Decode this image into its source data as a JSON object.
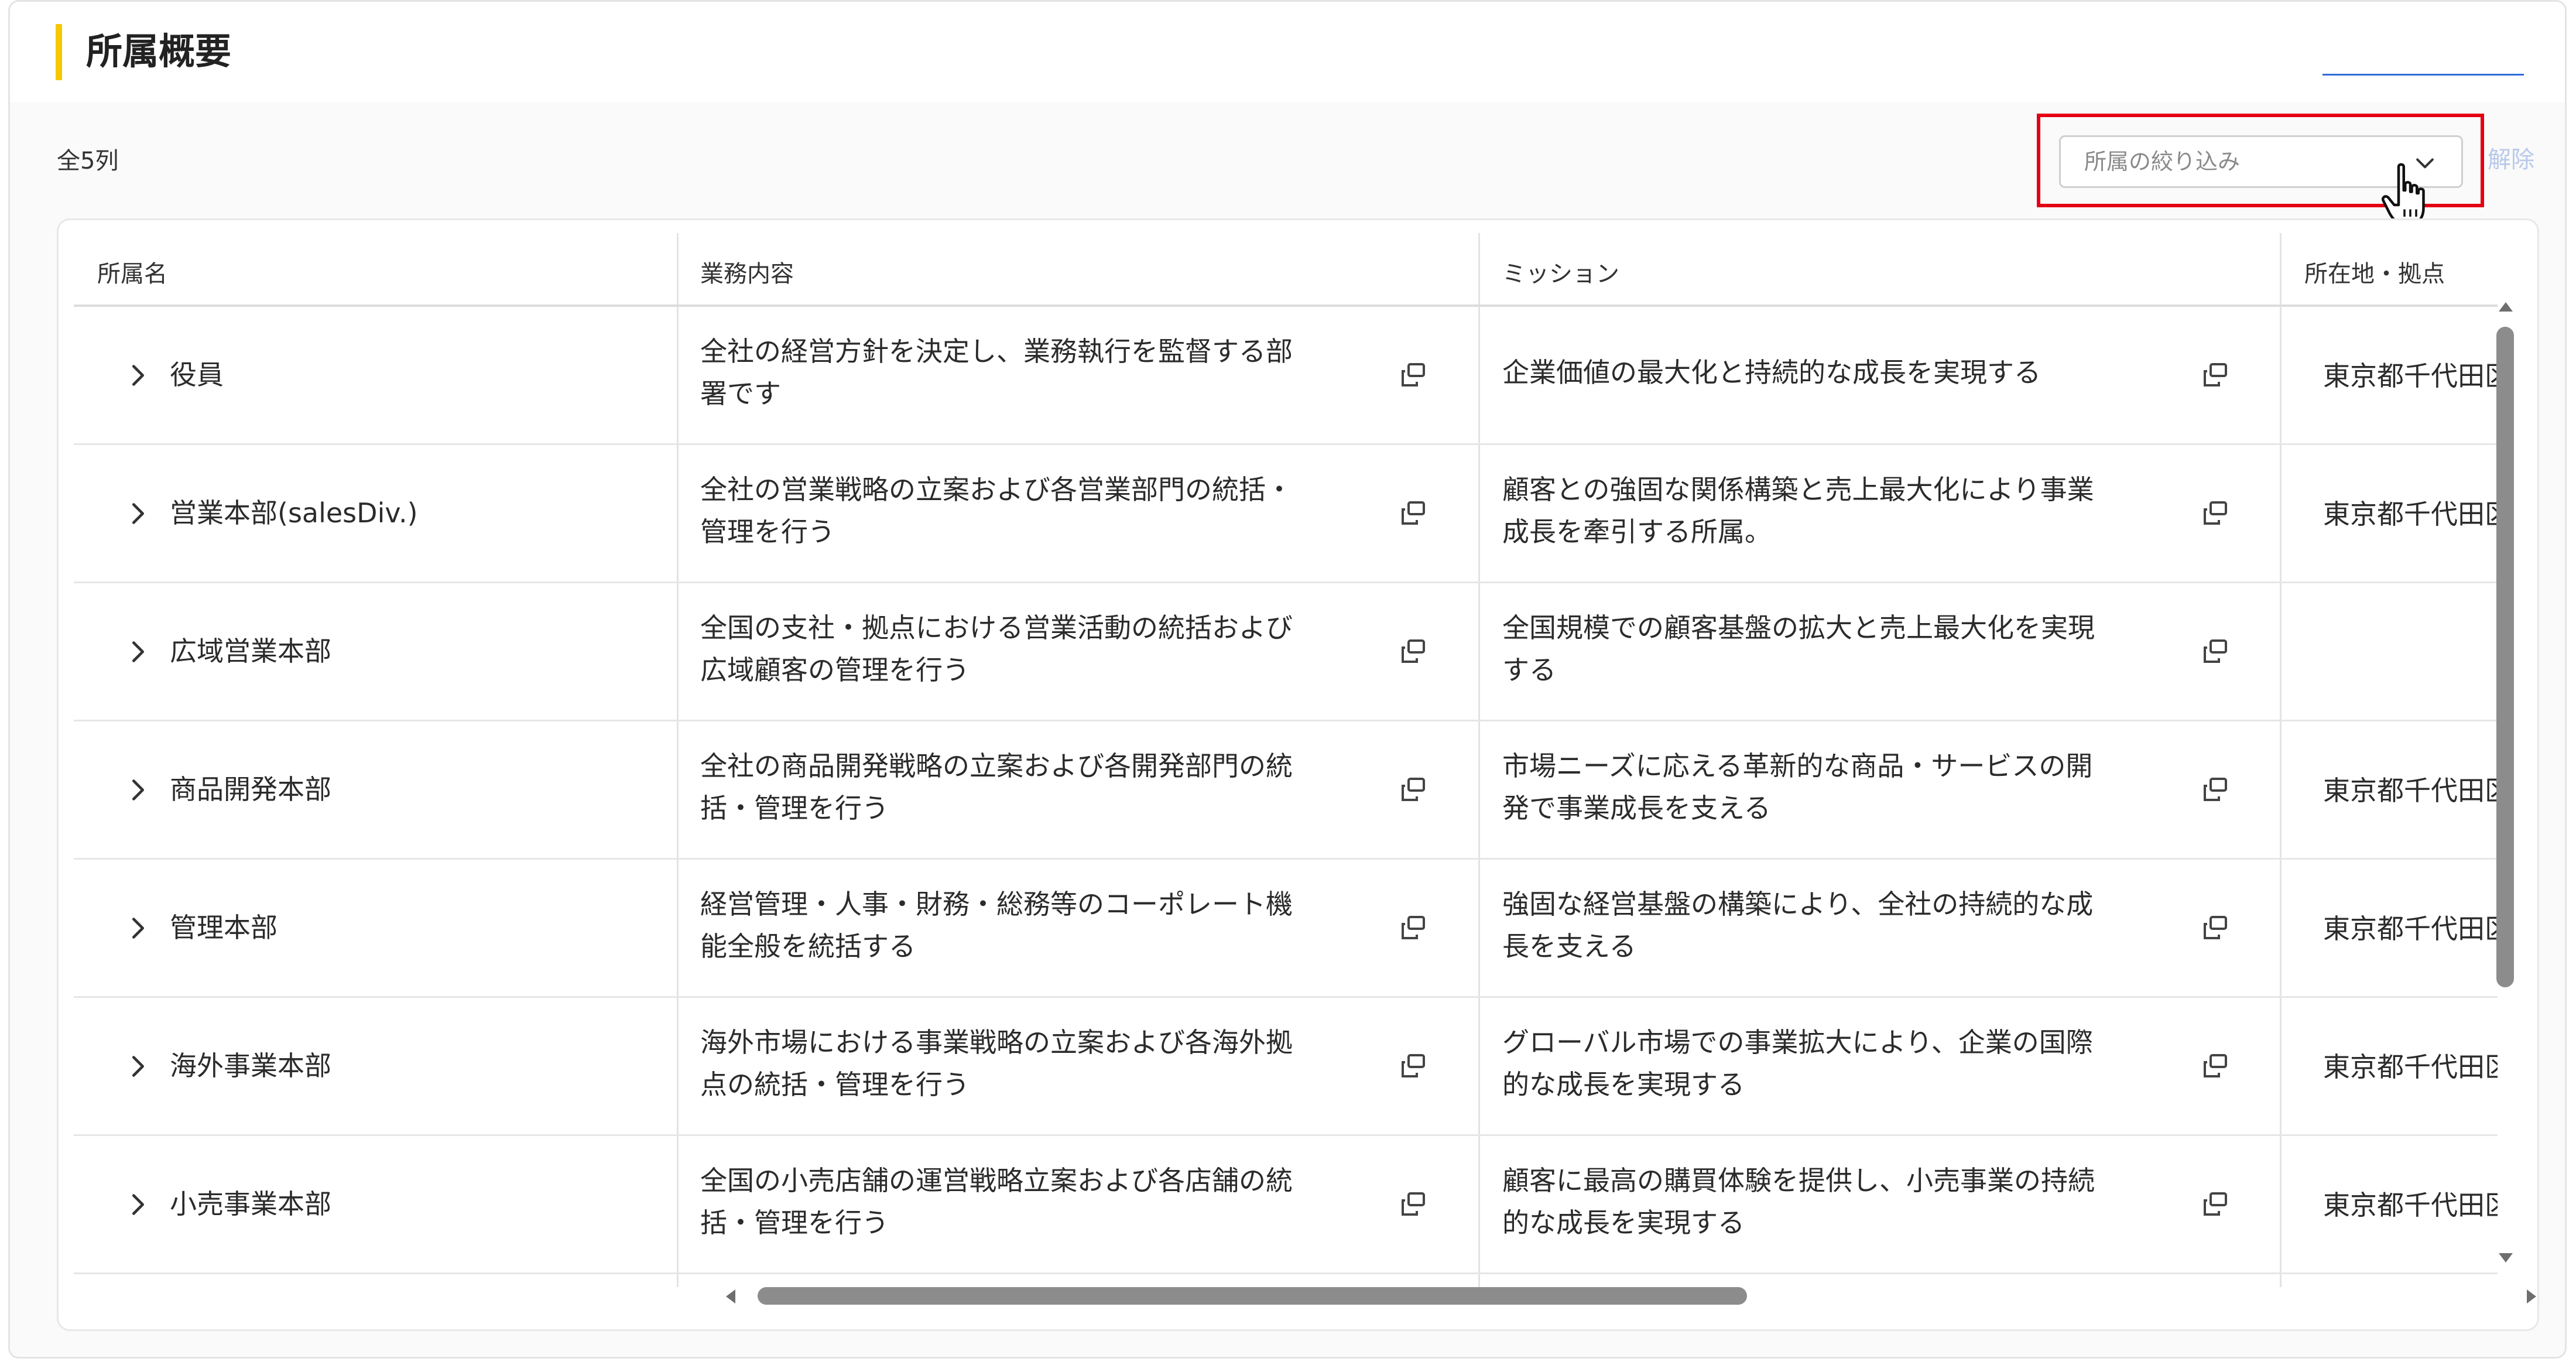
{
  "header": {
    "title": "所属概要"
  },
  "toolbar": {
    "count_label": "全5列",
    "filter_placeholder": "所属の絞り込み",
    "clear_label": "解除"
  },
  "table": {
    "columns": [
      "所属名",
      "業務内容",
      "ミッション",
      "所在地・拠点"
    ],
    "rows": [
      {
        "name": "役員",
        "business": [
          "全社の経営方針を決定し、業務執行を監督する部",
          "署です"
        ],
        "mission": [
          "企業価値の最大化と持続的な成長を実現する"
        ],
        "location": "東京都千代田区"
      },
      {
        "name": "営業本部(salesDiv.)",
        "business": [
          "全社の営業戦略の立案および各営業部門の統括・",
          "管理を行う"
        ],
        "mission": [
          "顧客との強固な関係構築と売上最大化により事業",
          "成長を牽引する所属。"
        ],
        "location": "東京都千代田区"
      },
      {
        "name": "広域営業本部",
        "business": [
          "全国の支社・拠点における営業活動の統括および",
          "広域顧客の管理を行う"
        ],
        "mission": [
          "全国規模での顧客基盤の拡大と売上最大化を実現",
          "する"
        ],
        "location": ""
      },
      {
        "name": "商品開発本部",
        "business": [
          "全社の商品開発戦略の立案および各開発部門の統",
          "括・管理を行う"
        ],
        "mission": [
          "市場ニーズに応える革新的な商品・サービスの開",
          "発で事業成長を支える"
        ],
        "location": "東京都千代田区"
      },
      {
        "name": "管理本部",
        "business": [
          "経営管理・人事・財務・総務等のコーポレート機",
          "能全般を統括する"
        ],
        "mission": [
          "強固な経営基盤の構築により、全社の持続的な成",
          "長を支える"
        ],
        "location": "東京都千代田区"
      },
      {
        "name": "海外事業本部",
        "business": [
          "海外市場における事業戦略の立案および各海外拠",
          "点の統括・管理を行う"
        ],
        "mission": [
          "グローバル市場での事業拡大により、企業の国際",
          "的な成長を実現する"
        ],
        "location": "東京都千代田区"
      },
      {
        "name": "小売事業本部",
        "business": [
          "全国の小売店舗の運営戦略立案および各店舗の統",
          "括・管理を行う"
        ],
        "mission": [
          "顧客に最高の購買体験を提供し、小売事業の持続",
          "的な成長を実現する"
        ],
        "location": "東京都千代田区"
      }
    ]
  },
  "icons": {
    "expand": "chevron-right-icon",
    "copy": "copy-icon",
    "dropdown": "chevron-down-icon",
    "cursor": "hand-pointer-icon"
  },
  "colors": {
    "accent": "#f5c800",
    "highlight": "#e40012",
    "link": "#2f6bd8"
  }
}
